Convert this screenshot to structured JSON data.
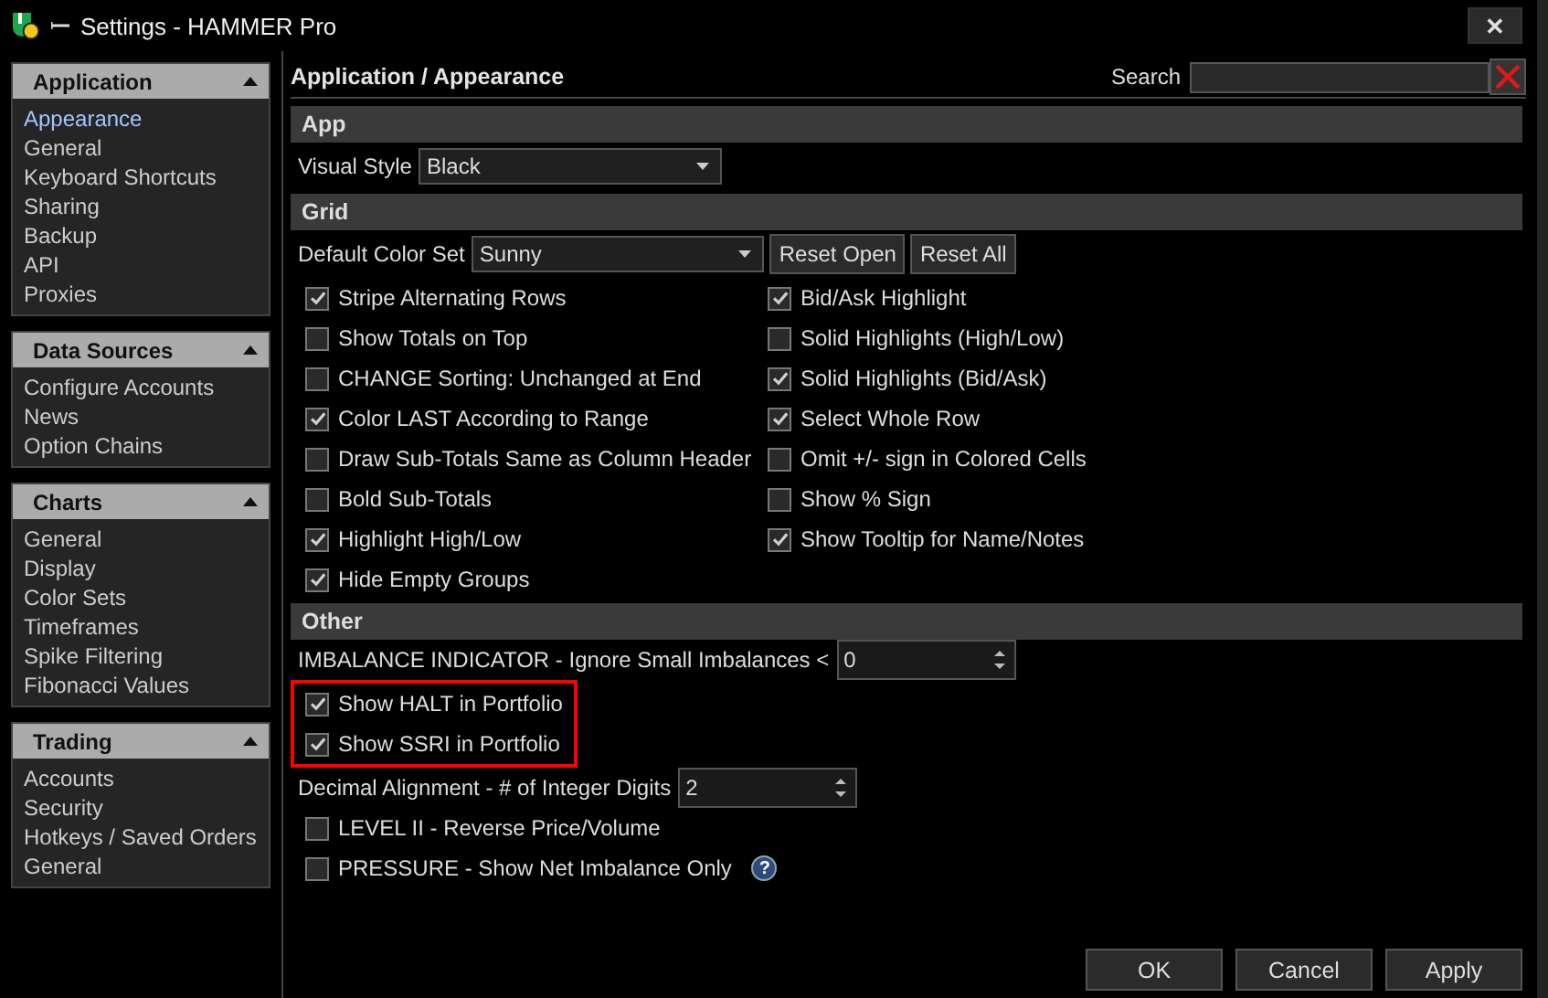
{
  "window": {
    "title": "Settings - HAMMER Pro",
    "close": "✕"
  },
  "sidebar": [
    {
      "title": "Application",
      "expanded": true,
      "items": [
        {
          "label": "Appearance",
          "selected": true
        },
        {
          "label": "General",
          "selected": false
        },
        {
          "label": "Keyboard Shortcuts",
          "selected": false
        },
        {
          "label": "Sharing",
          "selected": false
        },
        {
          "label": "Backup",
          "selected": false
        },
        {
          "label": "API",
          "selected": false
        },
        {
          "label": "Proxies",
          "selected": false
        }
      ]
    },
    {
      "title": "Data Sources",
      "expanded": true,
      "items": [
        {
          "label": "Configure Accounts",
          "selected": false
        },
        {
          "label": "News",
          "selected": false
        },
        {
          "label": "Option Chains",
          "selected": false
        }
      ]
    },
    {
      "title": "Charts",
      "expanded": true,
      "items": [
        {
          "label": "General",
          "selected": false
        },
        {
          "label": "Display",
          "selected": false
        },
        {
          "label": "Color Sets",
          "selected": false
        },
        {
          "label": "Timeframes",
          "selected": false
        },
        {
          "label": "Spike Filtering",
          "selected": false
        },
        {
          "label": "Fibonacci Values",
          "selected": false
        }
      ]
    },
    {
      "title": "Trading",
      "expanded": true,
      "items": [
        {
          "label": "Accounts",
          "selected": false
        },
        {
          "label": "Security",
          "selected": false
        },
        {
          "label": "Hotkeys / Saved Orders",
          "selected": false
        },
        {
          "label": "General",
          "selected": false
        }
      ]
    }
  ],
  "breadcrumb": "Application / Appearance",
  "search": {
    "label": "Search"
  },
  "app": {
    "title": "App",
    "visual_style_label": "Visual Style",
    "visual_style": "Black"
  },
  "grid": {
    "title": "Grid",
    "color_set_label": "Default Color Set",
    "color_set": "Sunny",
    "buttons": [
      "Reset Open",
      "Reset All"
    ],
    "left": [
      {
        "label": "Stripe Alternating Rows",
        "checked": true
      },
      {
        "label": "Show Totals on Top",
        "checked": false
      },
      {
        "label": "CHANGE Sorting: Unchanged at End",
        "checked": false
      },
      {
        "label": "Color LAST According to Range",
        "checked": true
      },
      {
        "label": "Draw Sub-Totals Same as Column Header",
        "checked": false
      },
      {
        "label": "Bold Sub-Totals",
        "checked": false
      },
      {
        "label": "Highlight High/Low",
        "checked": true
      },
      {
        "label": "Hide Empty Groups",
        "checked": true
      }
    ],
    "right": [
      {
        "label": "Bid/Ask Highlight",
        "checked": true
      },
      {
        "label": "Solid Highlights (High/Low)",
        "checked": false
      },
      {
        "label": "Solid Highlights (Bid/Ask)",
        "checked": true
      },
      {
        "label": "Select Whole Row",
        "checked": true
      },
      {
        "label": "Omit +/- sign in Colored Cells",
        "checked": false
      },
      {
        "label": "Show % Sign",
        "checked": false
      },
      {
        "label": "Show Tooltip for Name/Notes",
        "checked": true
      }
    ]
  },
  "other": {
    "title": "Other",
    "items": [
      {
        "kind": "spin",
        "label": "IMBALANCE INDICATOR - Ignore Small Imbalances <",
        "value": "0"
      },
      {
        "kind": "check",
        "label": "Show HALT in Portfolio",
        "checked": true,
        "highlighted": true
      },
      {
        "kind": "check",
        "label": "Show SSRI in Portfolio",
        "checked": true,
        "highlighted": true
      },
      {
        "kind": "spin",
        "label": "Decimal Alignment - # of Integer Digits",
        "value": "2"
      },
      {
        "kind": "check",
        "label": "LEVEL II - Reverse Price/Volume",
        "checked": false,
        "highlighted": false
      },
      {
        "kind": "check",
        "label": "PRESSURE - Show Net Imbalance Only",
        "checked": false,
        "highlighted": false,
        "help": "?"
      }
    ]
  },
  "buttons": [
    "OK",
    "Cancel",
    "Apply"
  ]
}
